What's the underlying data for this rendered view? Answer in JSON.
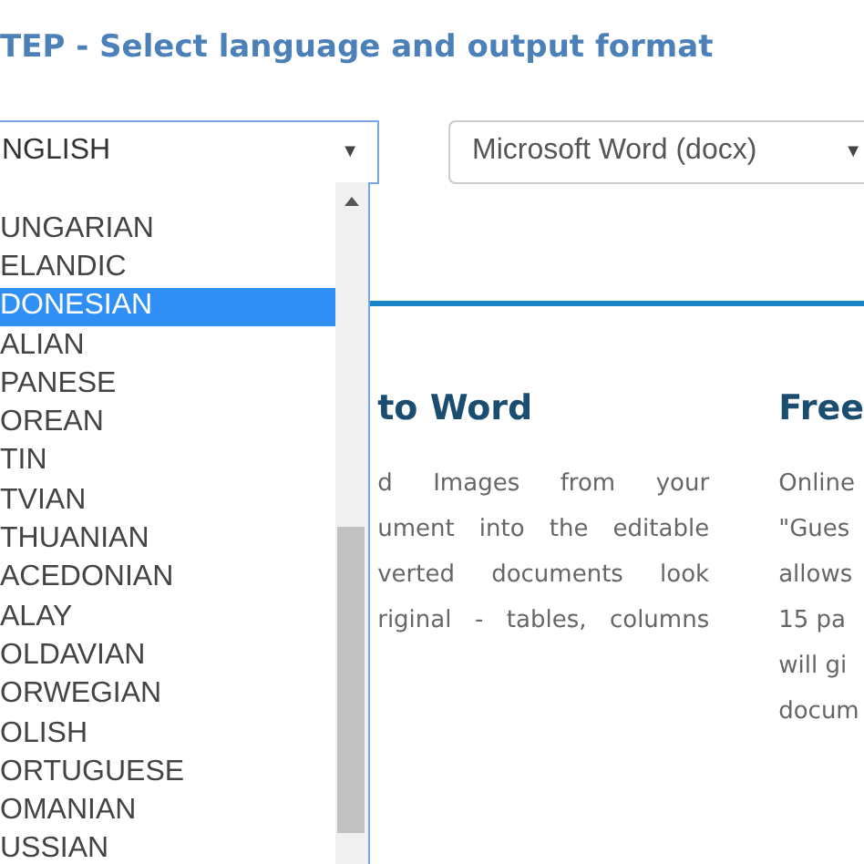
{
  "heading": "TEP - Select language and output format",
  "language_select": {
    "value": "NGLISH",
    "arrow": "▼"
  },
  "format_select": {
    "value": "Microsoft Word (docx)",
    "arrow": "▼"
  },
  "language_list": [
    {
      "label": "UNGARIAN",
      "selected": false
    },
    {
      "label": "ELANDIC",
      "selected": false
    },
    {
      "label": "DONESIAN",
      "selected": true
    },
    {
      "label": "ALIAN",
      "selected": false
    },
    {
      "label": "PANESE",
      "selected": false
    },
    {
      "label": "OREAN",
      "selected": false
    },
    {
      "label": "TIN",
      "selected": false
    },
    {
      "label": "TVIAN",
      "selected": false
    },
    {
      "label": "THUANIAN",
      "selected": false
    },
    {
      "label": "ACEDONIAN",
      "selected": false
    },
    {
      "label": "ALAY",
      "selected": false
    },
    {
      "label": "OLDAVIAN",
      "selected": false
    },
    {
      "label": "ORWEGIAN",
      "selected": false
    },
    {
      "label": "OLISH",
      "selected": false
    },
    {
      "label": "ORTUGUESE",
      "selected": false
    },
    {
      "label": "OMANIAN",
      "selected": false
    },
    {
      "label": "USSIAN",
      "selected": false
    }
  ],
  "columns": [
    {
      "title": "to Word",
      "lines": [
        "d Images from your",
        "ument into the editable",
        "verted documents look",
        "riginal - tables, columns"
      ]
    },
    {
      "title": "Free",
      "lines": [
        "Online",
        "\"Gues",
        "allows",
        "15 pa",
        "will gi",
        "docum"
      ]
    }
  ]
}
